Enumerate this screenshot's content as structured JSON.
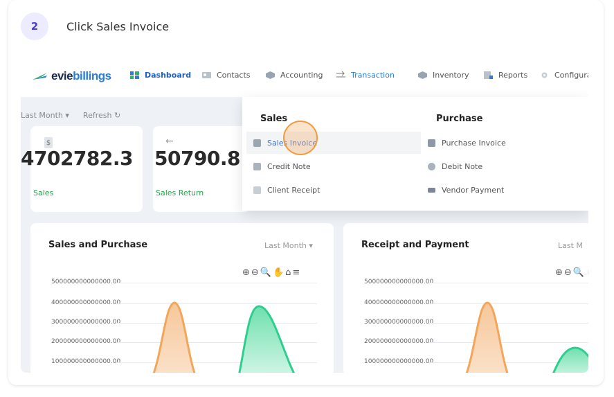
{
  "step": {
    "number": "2",
    "text": "Click Sales Invoice"
  },
  "brand": {
    "part1": "evie",
    "part2": "billings"
  },
  "nav": [
    {
      "label": "Dashboard",
      "icon": "dashboard-icon"
    },
    {
      "label": "Contacts",
      "icon": "contacts-icon"
    },
    {
      "label": "Accounting",
      "icon": "accounting-icon"
    },
    {
      "label": "Transaction",
      "icon": "transaction-icon"
    },
    {
      "label": "Inventory",
      "icon": "inventory-icon"
    },
    {
      "label": "Reports",
      "icon": "reports-icon"
    },
    {
      "label": "Configurati",
      "icon": "configuration-icon"
    }
  ],
  "filters": {
    "period": "Last Month",
    "period_icon": "▾",
    "refresh": "Refresh",
    "refresh_icon": "↻"
  },
  "tiles": [
    {
      "value": "4702782.3",
      "label": "Sales",
      "icon": "$"
    },
    {
      "value": "50790.8",
      "label": "Sales Return",
      "icon": "←"
    }
  ],
  "dropdown": {
    "sales_title": "Sales",
    "purchase_title": "Purchase",
    "sales_items": [
      "Sales Invoice",
      "Credit Note",
      "Client Receipt"
    ],
    "purchase_items": [
      "Purchase Invoice",
      "Debit Note",
      "Vendor Payment"
    ]
  },
  "panels": [
    {
      "title": "Sales and Purchase",
      "filter": "Last Month"
    },
    {
      "title": "Receipt and Payment",
      "filter": "Last M"
    }
  ],
  "toolbar_glyphs": "⊕⊖🔍✋⌂≡",
  "ticks": [
    "500000000000000.00",
    "400000000000000.00",
    "300000000000000.00",
    "200000000000000.00",
    "100000000000000.00"
  ],
  "colors": {
    "accent": "#2e7cd6",
    "sales_area": "#f3a65a",
    "purchase_area": "#2ecf8e",
    "cursor": "#f39a3a"
  }
}
